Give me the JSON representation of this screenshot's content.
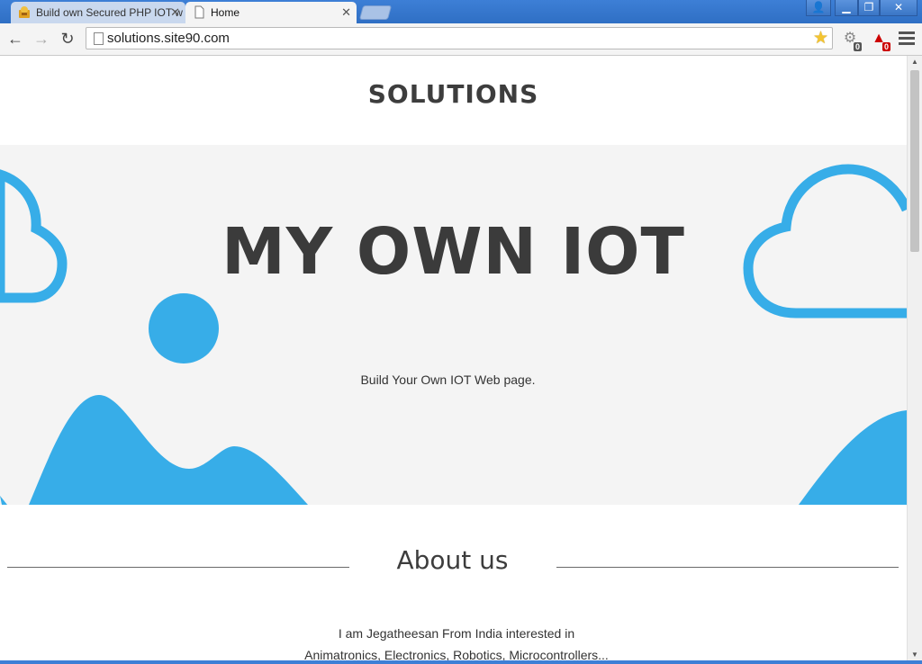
{
  "browser": {
    "tabs": [
      {
        "title": "Build own Secured PHP IOT w",
        "active": false,
        "icon": "php-iot-favicon-icon"
      },
      {
        "title": "Home",
        "active": true,
        "icon": "page-icon"
      }
    ],
    "close_glyph": "✕",
    "window_controls": {
      "profile": "👤",
      "minimize": "▁",
      "restore": "❐",
      "close": "✕"
    },
    "nav": {
      "back": "←",
      "forward": "→",
      "reload": "↻"
    },
    "url": "solutions.site90.com",
    "bookmark_star": "★",
    "extensions": [
      {
        "name": "extension-gear-icon",
        "glyph": "⚙",
        "badge": "0",
        "badge_color": "#666666"
      },
      {
        "name": "extension-alert-icon",
        "glyph": "▲",
        "badge": "0",
        "badge_color": "#cc0000"
      }
    ]
  },
  "page": {
    "brand": "SOLUTIONS",
    "hero": {
      "title": "MY OWN IOT",
      "subtitle": "Build Your Own IOT Web page."
    },
    "about": {
      "title": "About us",
      "line1": "I am Jegatheesan From India interested in",
      "line2": "Animatronics, Electronics, Robotics, Microcontrollers..."
    }
  },
  "scrollbar": {
    "up": "▲",
    "down": "▼"
  },
  "colors": {
    "accent": "#37ade8",
    "hero_bg": "#f4f4f4",
    "text": "#3d3d3d",
    "titlebar": "#3d7fd6"
  }
}
